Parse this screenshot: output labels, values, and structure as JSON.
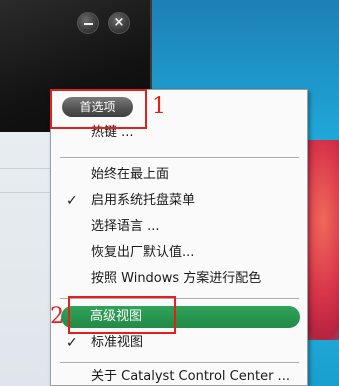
{
  "window": {
    "minimize_icon": "minimize-icon",
    "close_symbol": "×"
  },
  "menu": {
    "options_label": "首选项",
    "hotkeys_label": "热键 ...",
    "always_on_top_label": "始终在最上面",
    "enable_tray_label": "启用系统托盘菜单",
    "enable_tray_checked": true,
    "select_language_label": "选择语言 ...",
    "restore_defaults_label": "恢复出厂默认值...",
    "windows_color_label": "按照 Windows 方案进行配色",
    "advanced_view_label": "高级视图",
    "standard_view_label": "标准视图",
    "standard_view_checked": true,
    "about_label": "关于 Catalyst Control Center ..."
  },
  "annotations": {
    "marker_1": "1",
    "marker_2": "2"
  },
  "colors": {
    "highlight_green": "#228a46",
    "annotation_red": "#e2211c",
    "pill_dark": "#545454"
  }
}
